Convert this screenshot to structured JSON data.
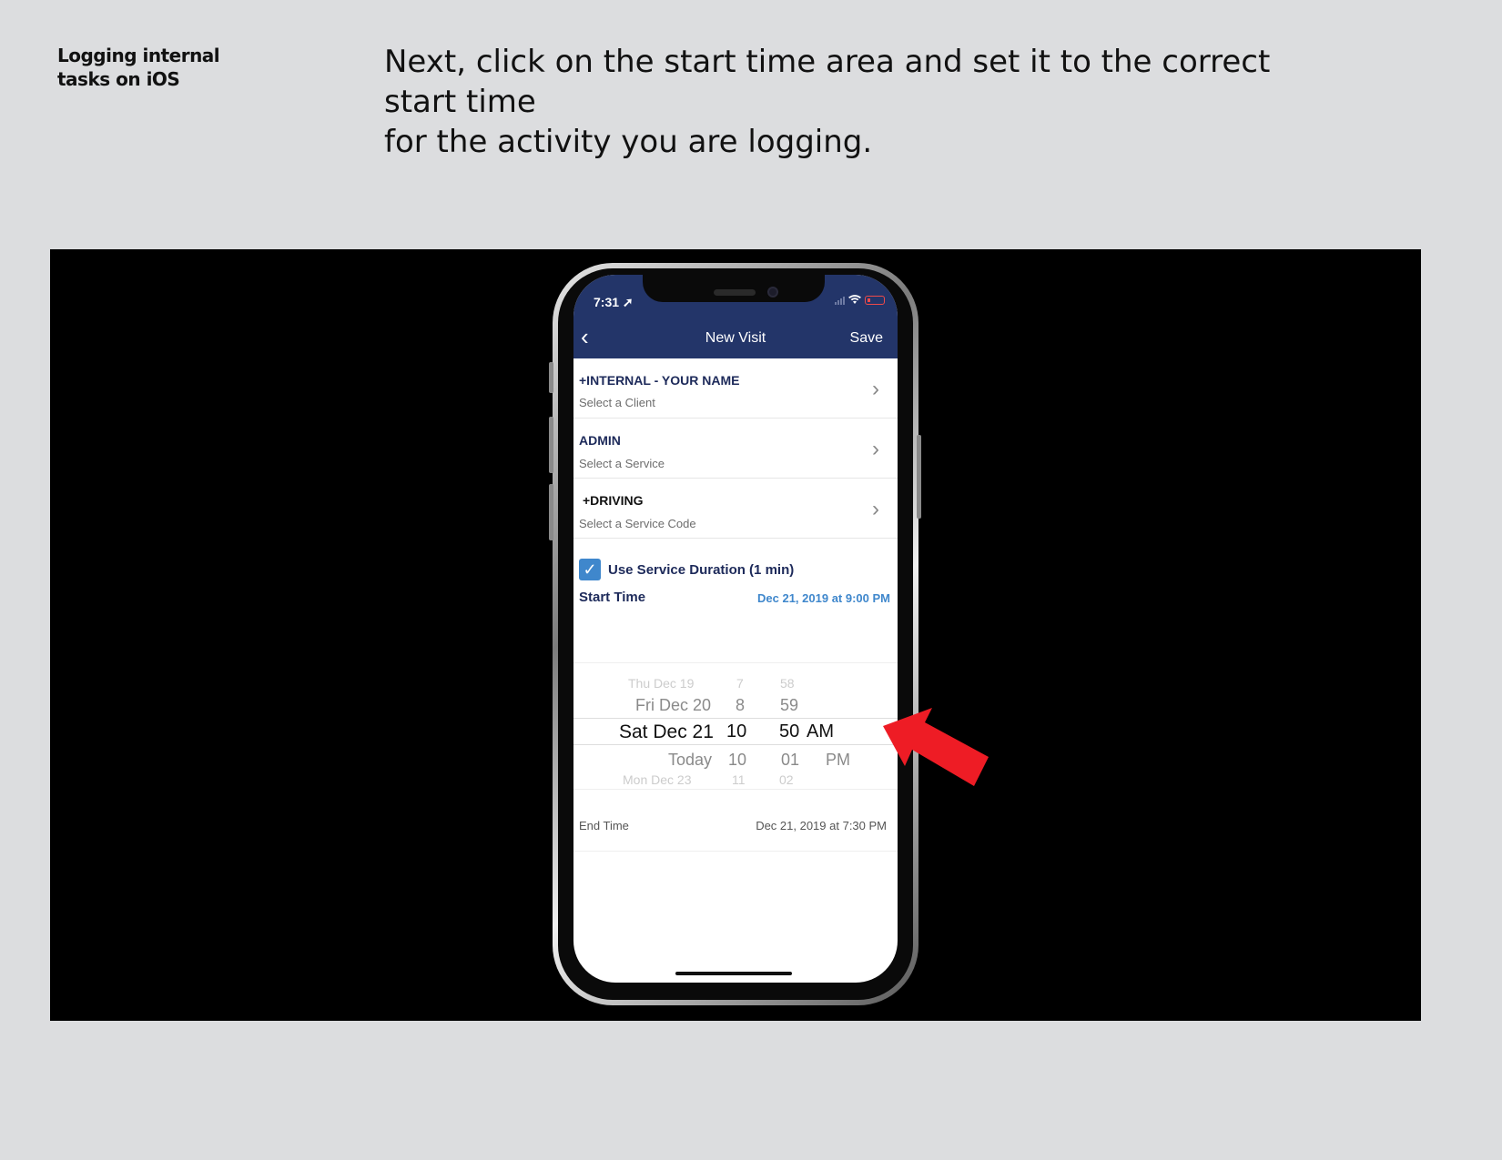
{
  "side_label": [
    "Logging internal",
    "tasks on iOS"
  ],
  "instruction": [
    "Next, click on the start time area and set it to the correct start time",
    "for the activity you are logging."
  ],
  "phone": {
    "status_time": "7:31",
    "nav_title": "New Visit",
    "nav_save": "Save",
    "back_icon": "chevron-left-icon",
    "rows": [
      {
        "title": "+INTERNAL - YOUR NAME",
        "sub": "Select a Client"
      },
      {
        "title": "ADMIN",
        "sub": "Select a Service"
      },
      {
        "title": "+DRIVING",
        "sub": "Select a Service Code"
      }
    ],
    "use_duration": "Use Service Duration (1 min)",
    "use_duration_checked": true,
    "start_label": "Start Time",
    "start_value": "Dec 21, 2019 at 9:00 PM",
    "picker": {
      "dates": [
        "Thu Dec 19",
        "Fri Dec 20",
        "Sat Dec 21",
        "Today",
        "Mon Dec 23"
      ],
      "hours": [
        "7",
        "8",
        "10",
        "10",
        "11"
      ],
      "minutes": [
        "58",
        "59",
        "50",
        "01",
        "02"
      ],
      "ampm": [
        "AM",
        "PM"
      ]
    },
    "end_label": "End Time",
    "end_value": "Dec 21, 2019 at 7:30 PM"
  },
  "colors": {
    "header": "#233569",
    "accent": "#3f87cc",
    "arrow": "#ee1c25",
    "page_bg": "#dcdddf"
  }
}
